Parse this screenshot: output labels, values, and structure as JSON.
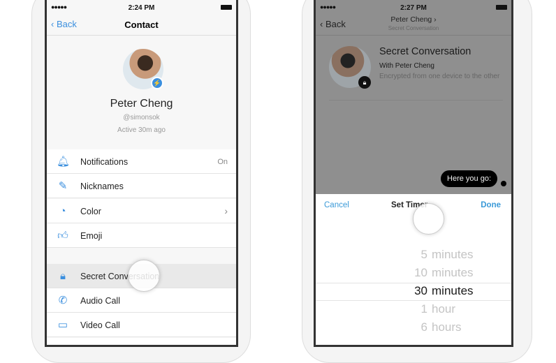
{
  "left": {
    "status": {
      "signal": "●●●●●",
      "time": "2:24 PM"
    },
    "nav": {
      "back": "Back",
      "title": "Contact"
    },
    "profile": {
      "name": "Peter Cheng",
      "username": "@simonsok",
      "active": "Active 30m ago"
    },
    "rows": [
      {
        "label": "Notifications",
        "value": "On",
        "icon": "bell-icon"
      },
      {
        "label": "Nicknames",
        "icon": "pencil-icon"
      },
      {
        "label": "Color",
        "icon": "palette-icon",
        "chevron": true
      },
      {
        "label": "Emoji",
        "icon": "thumbs-up-icon"
      }
    ],
    "rows2": [
      {
        "label": "Secret Conversation",
        "icon": "lock-icon"
      },
      {
        "label": "Audio Call",
        "icon": "phone-icon"
      },
      {
        "label": "Video Call",
        "icon": "video-icon"
      }
    ]
  },
  "right": {
    "status": {
      "signal": "●●●●●",
      "time": "2:27 PM"
    },
    "nav": {
      "back": "Back",
      "title": "Peter Cheng ›",
      "subtitle": "Secret Conversation"
    },
    "header": {
      "title": "Secret Conversation",
      "with": "With Peter Cheng",
      "desc": "Encrypted from one device to the other"
    },
    "message": "Here you go:",
    "sheet": {
      "cancel": "Cancel",
      "title": "Set Timer",
      "done": "Done"
    },
    "picker": [
      {
        "n": "5",
        "u": "minutes"
      },
      {
        "n": "10",
        "u": "minutes"
      },
      {
        "n": "30",
        "u": "minutes",
        "selected": true
      },
      {
        "n": "1",
        "u": "hour"
      },
      {
        "n": "6",
        "u": "hours"
      }
    ]
  },
  "colors": {
    "accent": "#3b8fde",
    "dim": "#8f8f8f"
  }
}
